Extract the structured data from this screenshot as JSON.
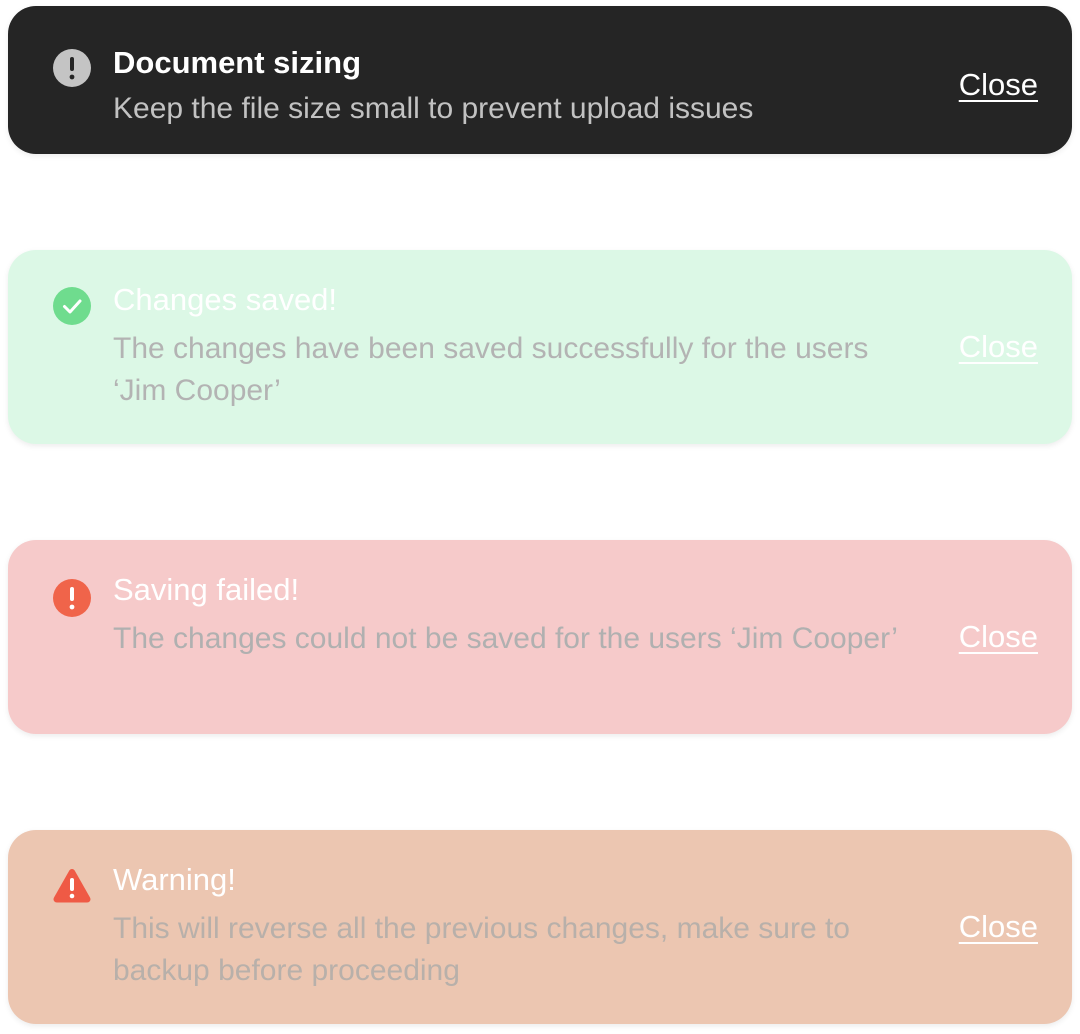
{
  "toasts": [
    {
      "variant": "info",
      "icon": "exclamation-circle-icon",
      "icon_color": "#c4c4c4",
      "background": "#252525",
      "title": "Document sizing",
      "message": "Keep the file size small to prevent upload issues",
      "close_label": "Close"
    },
    {
      "variant": "success",
      "icon": "check-circle-icon",
      "icon_color": "#6fdc8e",
      "background": "#dcf8e6",
      "title": "Changes saved!",
      "message": "The changes have been saved successfully for the users ‘Jim Cooper’",
      "close_label": "Close"
    },
    {
      "variant": "error",
      "icon": "exclamation-circle-icon",
      "icon_color": "#f0644a",
      "background": "#f6caca",
      "title": "Saving failed!",
      "message": "The changes could not be saved for the users ‘Jim Cooper’",
      "close_label": "Close"
    },
    {
      "variant": "warning",
      "icon": "warning-triangle-icon",
      "icon_color": "#ef5a45",
      "background": "#ecc6b1",
      "title": "Warning!",
      "message": "This will reverse all the previous changes, make sure to backup before proceeding",
      "close_label": "Close"
    }
  ]
}
